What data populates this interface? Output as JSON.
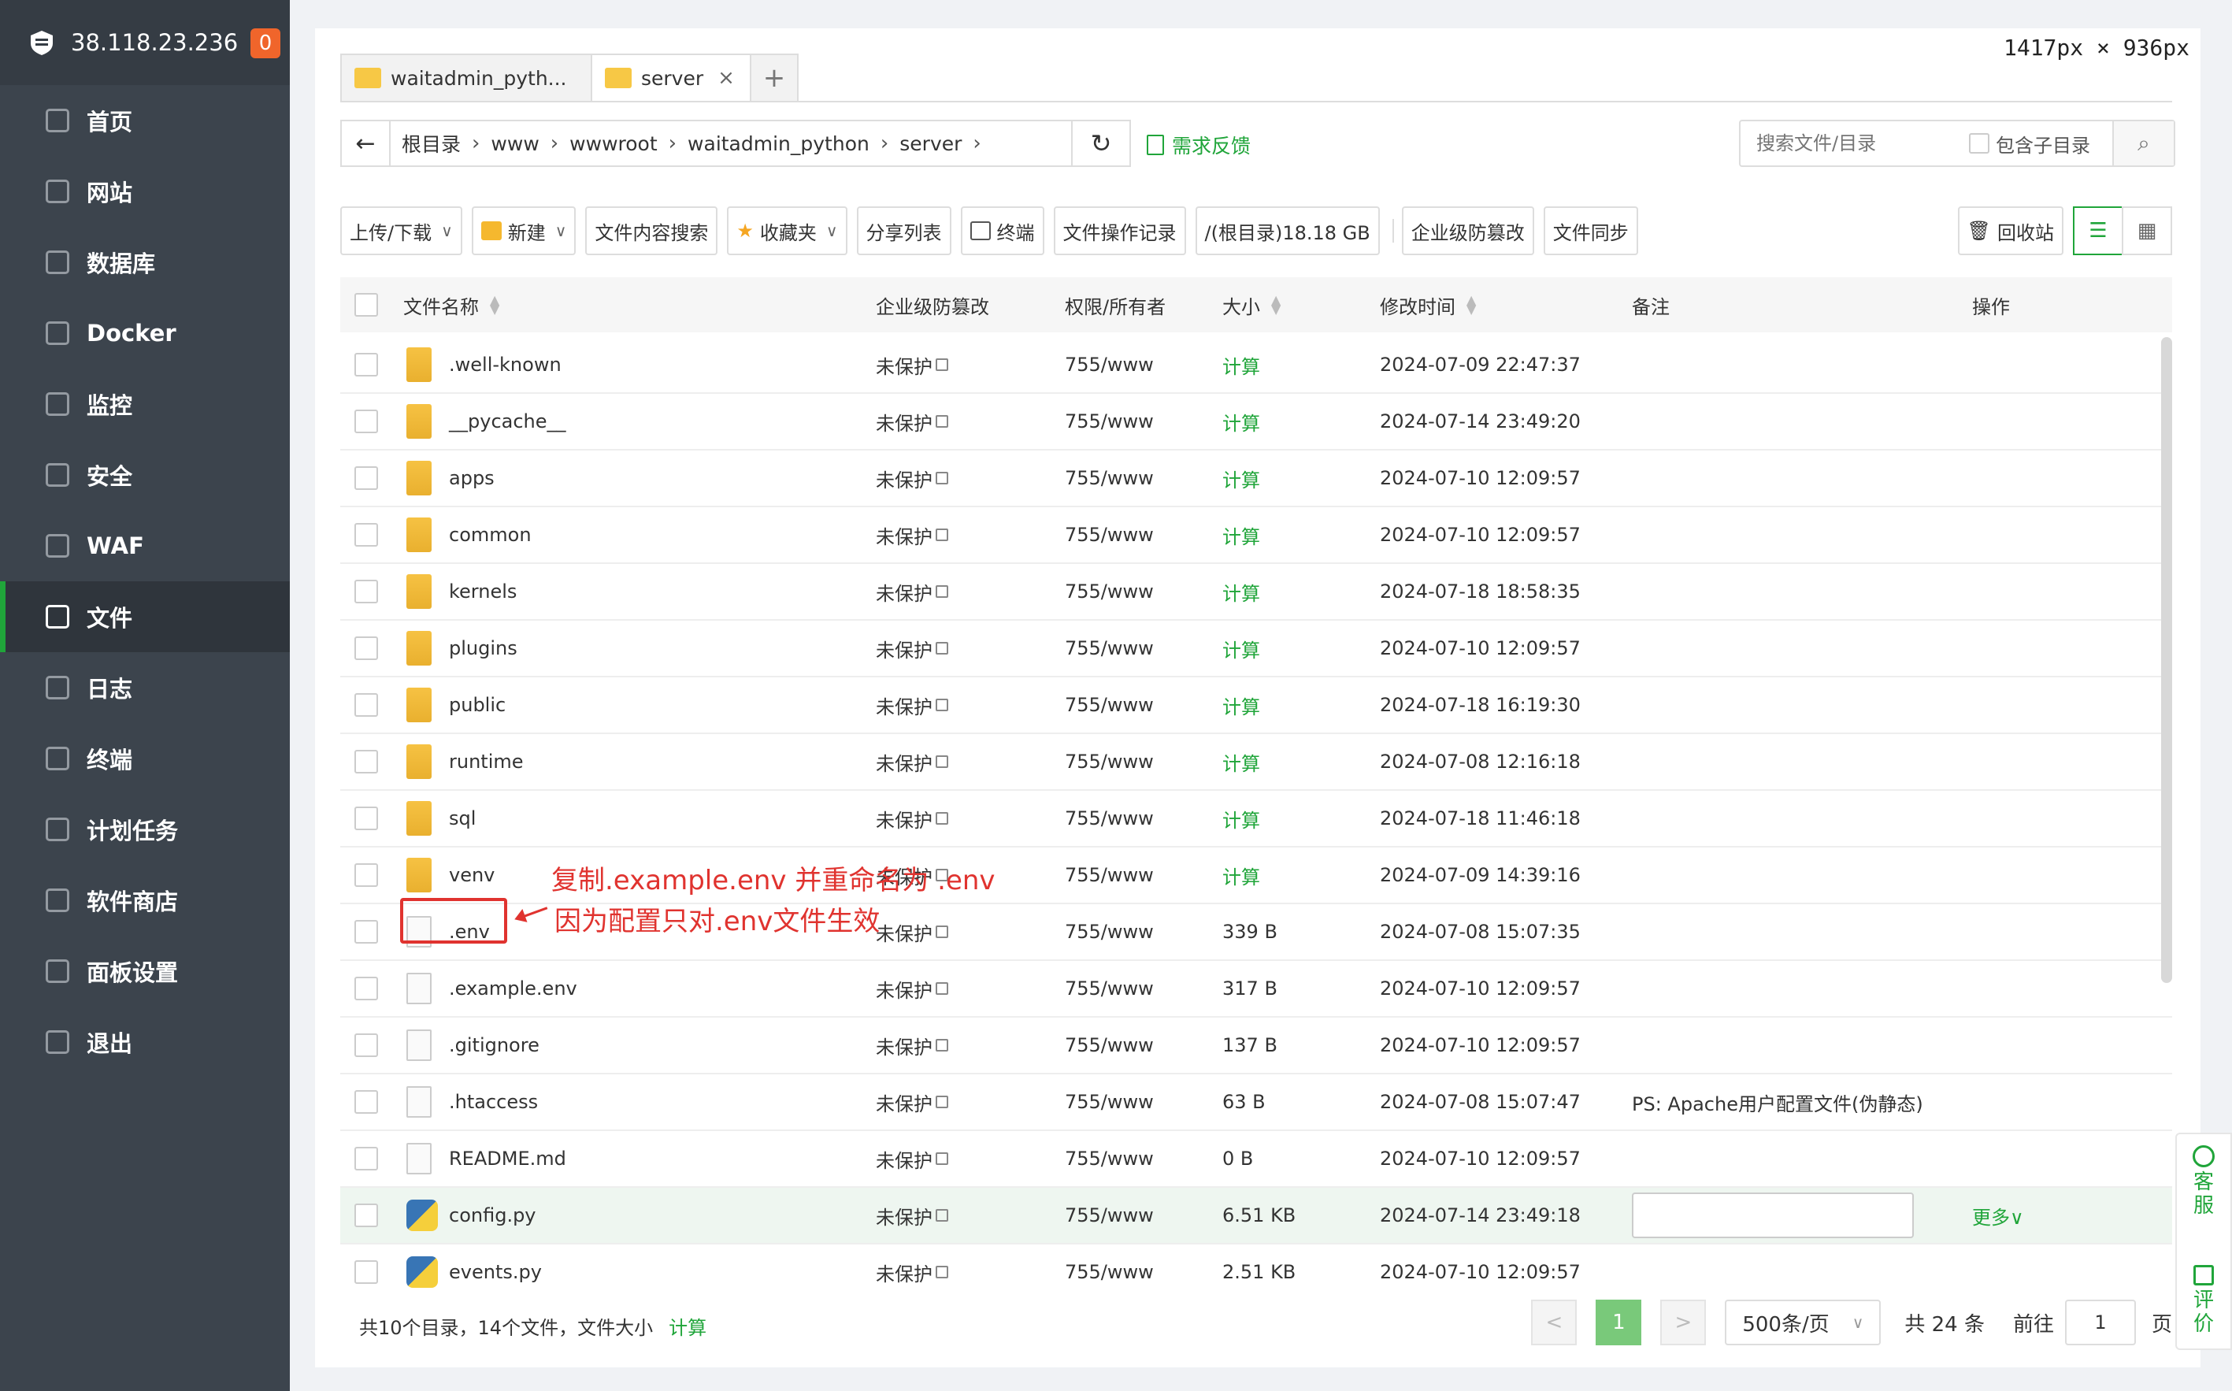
{
  "dimension_label": "1417px × 936px",
  "sidebar": {
    "host": "38.118.23.236",
    "badge": "0",
    "items": [
      {
        "label": "首页",
        "icon": "home-icon"
      },
      {
        "label": "网站",
        "icon": "globe-icon"
      },
      {
        "label": "数据库",
        "icon": "database-icon"
      },
      {
        "label": "Docker",
        "icon": "docker-icon"
      },
      {
        "label": "监控",
        "icon": "monitor-icon"
      },
      {
        "label": "安全",
        "icon": "shield-icon"
      },
      {
        "label": "WAF",
        "icon": "waf-shield-icon"
      },
      {
        "label": "文件",
        "icon": "folder-icon",
        "active": true
      },
      {
        "label": "日志",
        "icon": "log-icon"
      },
      {
        "label": "终端",
        "icon": "terminal-icon"
      },
      {
        "label": "计划任务",
        "icon": "calendar-icon"
      },
      {
        "label": "软件商店",
        "icon": "apps-icon"
      },
      {
        "label": "面板设置",
        "icon": "gear-icon"
      },
      {
        "label": "退出",
        "icon": "logout-icon"
      }
    ]
  },
  "tabs": [
    {
      "label": "waitadmin_pyth..."
    },
    {
      "label": "server",
      "close": "×"
    }
  ],
  "tab_add": "+",
  "path": {
    "crumbs": [
      "根目录",
      "www",
      "wwwroot",
      "waitadmin_python",
      "server"
    ],
    "feedback": "需求反馈"
  },
  "search": {
    "placeholder": "搜索文件/目录",
    "subdir_label": "包含子目录"
  },
  "toolbar": {
    "upload": "上传/下载",
    "new": "新建",
    "content_search": "文件内容搜索",
    "favorites": "收藏夹",
    "share_list": "分享列表",
    "terminal": "终端",
    "op_log": "文件操作记录",
    "disk": "/(根目录)18.18 GB",
    "tamper": "企业级防篡改",
    "sync": "文件同步",
    "recycle": "回收站"
  },
  "columns": {
    "name": "文件名称",
    "tamper": "企业级防篡改",
    "perm": "权限/所有者",
    "size": "大小",
    "mtime": "修改时间",
    "remark": "备注",
    "ops": "操作"
  },
  "rows": [
    {
      "name": ".well-known",
      "type": "folder",
      "tamper": "未保护",
      "perm": "755/www",
      "size": "计算",
      "mtime": "2024-07-09 22:47:37",
      "remark": ""
    },
    {
      "name": "__pycache__",
      "type": "folder",
      "tamper": "未保护",
      "perm": "755/www",
      "size": "计算",
      "mtime": "2024-07-14 23:49:20",
      "remark": ""
    },
    {
      "name": "apps",
      "type": "folder",
      "tamper": "未保护",
      "perm": "755/www",
      "size": "计算",
      "mtime": "2024-07-10 12:09:57",
      "remark": ""
    },
    {
      "name": "common",
      "type": "folder",
      "tamper": "未保护",
      "perm": "755/www",
      "size": "计算",
      "mtime": "2024-07-10 12:09:57",
      "remark": ""
    },
    {
      "name": "kernels",
      "type": "folder",
      "tamper": "未保护",
      "perm": "755/www",
      "size": "计算",
      "mtime": "2024-07-18 18:58:35",
      "remark": ""
    },
    {
      "name": "plugins",
      "type": "folder",
      "tamper": "未保护",
      "perm": "755/www",
      "size": "计算",
      "mtime": "2024-07-10 12:09:57",
      "remark": ""
    },
    {
      "name": "public",
      "type": "folder",
      "tamper": "未保护",
      "perm": "755/www",
      "size": "计算",
      "mtime": "2024-07-18 16:19:30",
      "remark": ""
    },
    {
      "name": "runtime",
      "type": "folder",
      "tamper": "未保护",
      "perm": "755/www",
      "size": "计算",
      "mtime": "2024-07-08 12:16:18",
      "remark": ""
    },
    {
      "name": "sql",
      "type": "folder",
      "tamper": "未保护",
      "perm": "755/www",
      "size": "计算",
      "mtime": "2024-07-18 11:46:18",
      "remark": ""
    },
    {
      "name": "venv",
      "type": "folder",
      "tamper": "未保护",
      "perm": "755/www",
      "size": "计算",
      "mtime": "2024-07-09 14:39:16",
      "remark": ""
    },
    {
      "name": ".env",
      "type": "file",
      "tamper": "未保护",
      "perm": "755/www",
      "size": "339 B",
      "mtime": "2024-07-08 15:07:35",
      "remark": ""
    },
    {
      "name": ".example.env",
      "type": "file",
      "tamper": "未保护",
      "perm": "755/www",
      "size": "317 B",
      "mtime": "2024-07-10 12:09:57",
      "remark": ""
    },
    {
      "name": ".gitignore",
      "type": "file",
      "tamper": "未保护",
      "perm": "755/www",
      "size": "137 B",
      "mtime": "2024-07-10 12:09:57",
      "remark": ""
    },
    {
      "name": ".htaccess",
      "type": "file",
      "tamper": "未保护",
      "perm": "755/www",
      "size": "63 B",
      "mtime": "2024-07-08 15:07:47",
      "remark": "PS: Apache用户配置文件(伪静态)"
    },
    {
      "name": "README.md",
      "type": "file",
      "tamper": "未保护",
      "perm": "755/www",
      "size": "0 B",
      "mtime": "2024-07-10 12:09:57",
      "remark": ""
    },
    {
      "name": "config.py",
      "type": "python",
      "tamper": "未保护",
      "perm": "755/www",
      "size": "6.51 KB",
      "mtime": "2024-07-14 23:49:18",
      "remark": "",
      "hover": true,
      "more": "更多∨"
    },
    {
      "name": "events.py",
      "type": "python",
      "tamper": "未保护",
      "perm": "755/www",
      "size": "2.51 KB",
      "mtime": "2024-07-10 12:09:57",
      "remark": ""
    }
  ],
  "annotation": {
    "line1": "复制.example.env 并重命名为 .env",
    "line2": "因为配置只对.env文件生效"
  },
  "footer": {
    "summary": "共10个目录，14个文件，文件大小",
    "calc": "计算",
    "prev": "<",
    "page": "1",
    "next": ">",
    "per_page": "500条/页",
    "total": "共 24 条",
    "goto": "前往",
    "goto_value": "1",
    "page_suffix": "页"
  },
  "service": {
    "kefu": "客服",
    "rate": "评价"
  },
  "colors": {
    "accent": "#20a53a",
    "sidebar": "#3c444d",
    "annotation": "#e0332f"
  }
}
